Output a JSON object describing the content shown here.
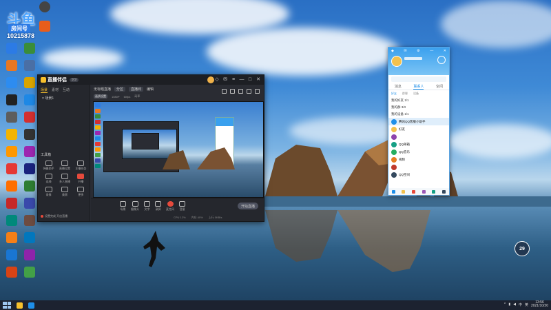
{
  "overlay": {
    "logo": "斗鱼",
    "room_label": "房间号",
    "room_number": "10215878"
  },
  "desktop_icons": [
    {
      "label": "",
      "color": "#2c7be5"
    },
    {
      "label": "",
      "color": "#3a8d3a"
    },
    {
      "label": "",
      "color": "#e87722"
    },
    {
      "label": "",
      "color": "#4a6fa5"
    },
    {
      "label": "",
      "color": "#2d8cf0"
    },
    {
      "label": "",
      "color": "#d9a400"
    },
    {
      "label": "",
      "color": "#222222"
    },
    {
      "label": "",
      "color": "#1e88e5"
    },
    {
      "label": "",
      "color": "#5d5d5d"
    },
    {
      "label": "",
      "color": "#d32f2f"
    },
    {
      "label": "",
      "color": "#f4b400"
    },
    {
      "label": "",
      "color": "#333333"
    },
    {
      "label": "",
      "color": "#ff9800"
    },
    {
      "label": "",
      "color": "#9c27b0"
    },
    {
      "label": "",
      "color": "#e53935"
    },
    {
      "label": "",
      "color": "#1a237e"
    },
    {
      "label": "",
      "color": "#ff6f00"
    },
    {
      "label": "",
      "color": "#2e7d32"
    },
    {
      "label": "",
      "color": "#c62828"
    },
    {
      "label": "",
      "color": "#3949ab"
    },
    {
      "label": "",
      "color": "#00897b"
    },
    {
      "label": "",
      "color": "#6d4c41"
    },
    {
      "label": "",
      "color": "#f57f17"
    },
    {
      "label": "",
      "color": "#0277bd"
    },
    {
      "label": "",
      "color": "#1976d2"
    },
    {
      "label": "",
      "color": "#8e24aa"
    },
    {
      "label": "",
      "color": "#d84315"
    },
    {
      "label": "",
      "color": "#43a047"
    }
  ],
  "app": {
    "name": "直播伴侣",
    "version": "9.9",
    "left_tabs": [
      "场景",
      "素材",
      "互动"
    ],
    "left_row": "□ 场景1",
    "tools_label": "工具箱",
    "tools": [
      {
        "label": "弹幕助手",
        "red": false
      },
      {
        "label": "直播设置",
        "red": false
      },
      {
        "label": "主播任务",
        "red": false
      },
      {
        "label": "连线",
        "red": false
      },
      {
        "label": "多人直播",
        "red": false
      },
      {
        "label": "开播",
        "red": true
      },
      {
        "label": "录像",
        "red": false
      },
      {
        "label": "美颜",
        "red": false
      },
      {
        "label": "更多",
        "red": false
      }
    ],
    "notice": "设置完成 开启直播",
    "top_bar": [
      "无标题直播",
      "分区",
      "直播间",
      "编辑"
    ],
    "sub_bar": [
      "画质设置",
      "1080P",
      "60fps",
      "码率"
    ],
    "bottom_tools": [
      {
        "label": "场景",
        "red": false
      },
      {
        "label": "摄像头",
        "red": false
      },
      {
        "label": "文字",
        "red": false
      },
      {
        "label": "录屏",
        "red": false
      },
      {
        "label": "麦克风",
        "red": true
      },
      {
        "label": "音量",
        "red": false
      }
    ],
    "live_button": "开始直播",
    "status": [
      "CPU 12%",
      "内存 40%",
      "上行 0KB/s"
    ]
  },
  "qq": {
    "tabs": [
      "消息",
      "联系人",
      "空间"
    ],
    "active_tab": 1,
    "sub_tabs": [
      "好友",
      "群聊",
      "设备"
    ],
    "groups": [
      "我的好友 1/1",
      "我的群 3/3",
      "我的设备 1/1"
    ],
    "contacts": [
      {
        "name": "腾讯QQ客服小助手",
        "color": "#1e8fe9",
        "selected": true
      },
      {
        "name": "好友",
        "color": "#f2c14e",
        "selected": false
      },
      {
        "name": "",
        "color": "#8e44ad",
        "selected": false
      },
      {
        "name": "QQ邮箱",
        "color": "#16a085",
        "selected": false
      },
      {
        "name": "QQ音乐",
        "color": "#27ae60",
        "selected": false
      },
      {
        "name": "视频",
        "color": "#e67e22",
        "selected": false
      },
      {
        "name": "",
        "color": "#c0392b",
        "selected": false
      },
      {
        "name": "QQ空间",
        "color": "#34495e",
        "selected": false
      }
    ]
  },
  "widget": {
    "value": "29"
  },
  "taskbar": {
    "tray": [
      "^",
      "中",
      "英"
    ],
    "time": "13:56",
    "date": "2021/10/20"
  },
  "colors": {
    "accent": "#f7c02c",
    "qq_blue": "#1e8fe9",
    "live_red": "#e64a3c",
    "taskbar": "#1c2230"
  }
}
